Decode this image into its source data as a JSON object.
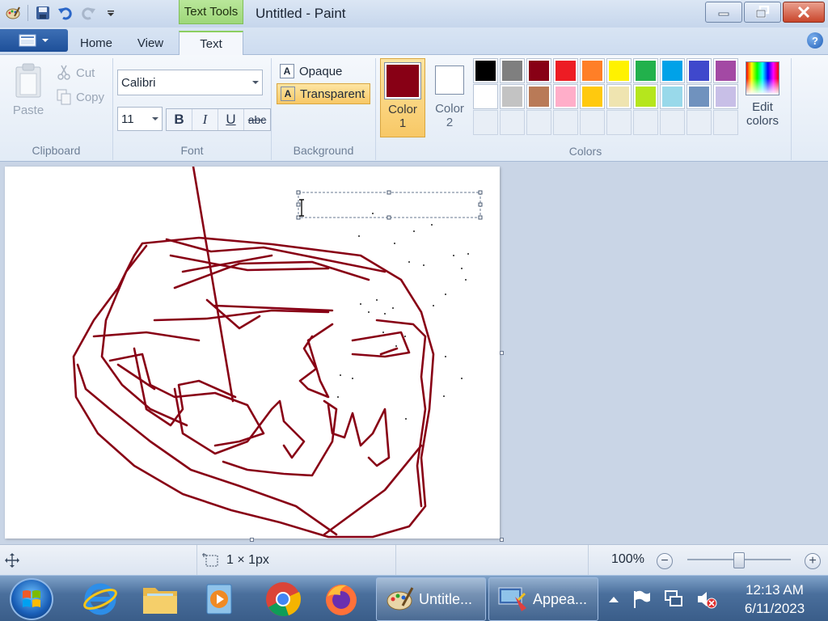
{
  "window": {
    "title": "Untitled - Paint",
    "contextual_tab": "Text Tools"
  },
  "tabs": [
    {
      "label": "Home"
    },
    {
      "label": "View"
    },
    {
      "label": "Text",
      "active": true
    }
  ],
  "ribbon": {
    "clipboard": {
      "paste": "Paste",
      "cut": "Cut",
      "copy": "Copy",
      "group_label": "Clipboard"
    },
    "font": {
      "family": "Calibri",
      "size": "11",
      "bold": "B",
      "italic": "I",
      "underline": "U",
      "strikethrough": "abc",
      "group_label": "Font"
    },
    "background": {
      "opaque": "Opaque",
      "transparent": "Transparent",
      "selected": "Transparent",
      "group_label": "Background"
    },
    "colors": {
      "color1_label": "Color\n1",
      "color1_line1": "Color",
      "color1_line2": "1",
      "color1_value": "#880015",
      "color2_line1": "Color",
      "color2_line2": "2",
      "color2_value": "#ffffff",
      "palette_row1": [
        "#000000",
        "#7f7f7f",
        "#880015",
        "#ed1c24",
        "#ff7f27",
        "#fff200",
        "#22b14c",
        "#00a2e8",
        "#3f48cc",
        "#a349a4"
      ],
      "palette_row2": [
        "#ffffff",
        "#c3c3c3",
        "#b97a57",
        "#ffaec9",
        "#ffc90e",
        "#efe4b0",
        "#b5e61d",
        "#99d9ea",
        "#7092be",
        "#c8bfe7"
      ],
      "edit_line1": "Edit",
      "edit_line2": "colors",
      "group_label": "Colors"
    }
  },
  "canvas": {
    "stroke_color": "#880015"
  },
  "statusbar": {
    "selection_size": "1 × 1px",
    "zoom": "100%"
  },
  "taskbar": {
    "pinned": [
      "internet-explorer-icon",
      "file-explorer-icon",
      "media-player-icon",
      "chrome-icon",
      "firefox-icon"
    ],
    "paint_button": "Untitle...",
    "appearance_button": "Appea...",
    "time": "12:13 AM",
    "date": "6/11/2023"
  }
}
